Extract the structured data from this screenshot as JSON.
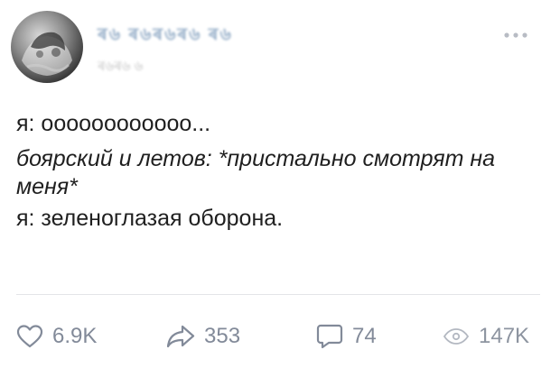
{
  "post": {
    "author_name": "ৰ৬ ৰ৬ৰ৬ৰ৬ ৰ৬",
    "time": "ৰ৬ৰ৬ ৬",
    "more_icon": "more-horizontal-icon",
    "text": {
      "line1": "я: оооооооооооо...",
      "line2": "боярский и летов: *пристально смотрят на меня*",
      "line3": "я: зеленоглазая оборона."
    }
  },
  "actions": {
    "likes": "6.9K",
    "shares": "353",
    "comments": "74",
    "views": "147K",
    "icons": {
      "like": "heart-icon",
      "share": "share-arrow-icon",
      "comment": "comment-bubble-icon",
      "views": "eye-icon"
    }
  },
  "colors": {
    "text": "#1f1f1f",
    "secondary": "#828a99",
    "divider": "#e3e4e8",
    "author_link": "#3d6a9a"
  }
}
